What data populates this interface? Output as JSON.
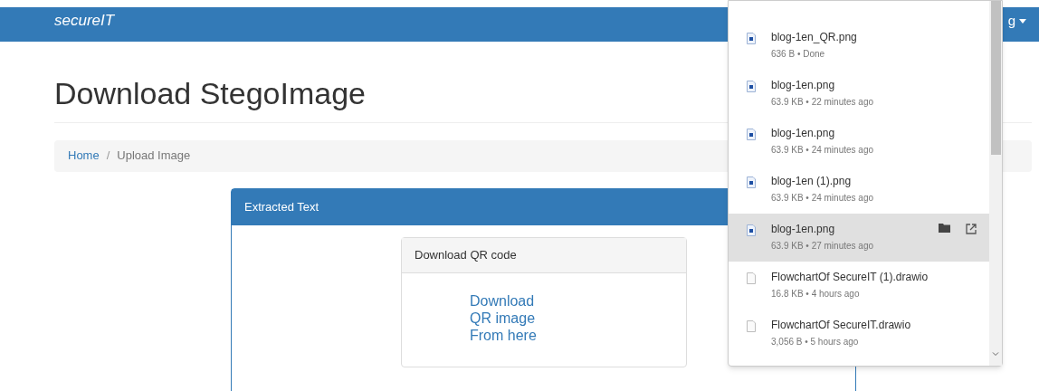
{
  "navbar": {
    "brand": "secureIT",
    "user_menu": "g"
  },
  "page_title": "Download StegoImage",
  "breadcrumb": [
    {
      "label": "Home",
      "kind": "link"
    },
    {
      "label": "/",
      "kind": "separator"
    },
    {
      "label": "Upload Image",
      "kind": "current"
    }
  ],
  "panel": {
    "title": "Extracted Text",
    "inner_panel": {
      "title": "Download QR code",
      "link_lines": [
        "Download",
        "QR image",
        "From here"
      ]
    }
  },
  "downloads": [
    {
      "name": "blog-1en_QR.png",
      "info": "636 B • Done",
      "kind": "image",
      "selected": false
    },
    {
      "name": "blog-1en.png",
      "info": "63.9 KB • 22 minutes ago",
      "kind": "image",
      "selected": false
    },
    {
      "name": "blog-1en.png",
      "info": "63.9 KB • 24 minutes ago",
      "kind": "image",
      "selected": false
    },
    {
      "name": "blog-1en (1).png",
      "info": "63.9 KB • 24 minutes ago",
      "kind": "image",
      "selected": false
    },
    {
      "name": "blog-1en.png",
      "info": "63.9 KB • 27 minutes ago",
      "kind": "image",
      "selected": true
    },
    {
      "name": "FlowchartOf SecureIT (1).drawio",
      "info": "16.8 KB • 4 hours ago",
      "kind": "file",
      "selected": false
    },
    {
      "name": "FlowchartOf SecureIT.drawio",
      "info": "3,056 B • 5 hours ago",
      "kind": "file",
      "selected": false
    }
  ]
}
